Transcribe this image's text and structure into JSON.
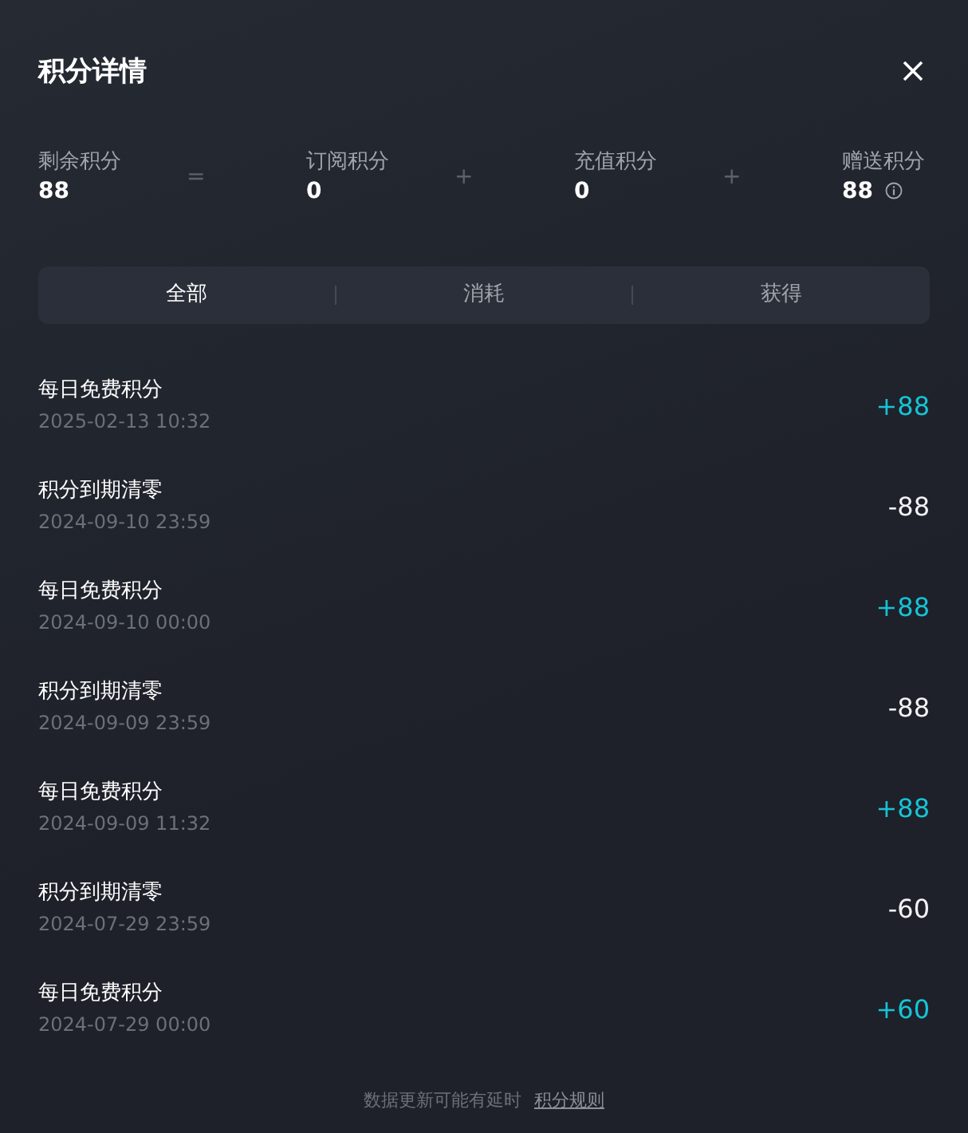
{
  "title": "积分详情",
  "summary": [
    {
      "label": "剩余积分",
      "value": "88",
      "operator": "=",
      "info": false
    },
    {
      "label": "订阅积分",
      "value": "0",
      "operator": "+",
      "info": false
    },
    {
      "label": "充值积分",
      "value": "0",
      "operator": "+",
      "info": false
    },
    {
      "label": "赠送积分",
      "value": "88",
      "info": true
    }
  ],
  "tabs": [
    {
      "label": "全部",
      "selected": true
    },
    {
      "label": "消耗",
      "selected": false
    },
    {
      "label": "获得",
      "selected": false
    }
  ],
  "records": [
    {
      "title": "每日免费积分",
      "time": "2025-02-13 10:32",
      "amount": "+88",
      "kind": "gain"
    },
    {
      "title": "积分到期清零",
      "time": "2024-09-10 23:59",
      "amount": "-88",
      "kind": "loss"
    },
    {
      "title": "每日免费积分",
      "time": "2024-09-10 00:00",
      "amount": "+88",
      "kind": "gain"
    },
    {
      "title": "积分到期清零",
      "time": "2024-09-09 23:59",
      "amount": "-88",
      "kind": "loss"
    },
    {
      "title": "每日免费积分",
      "time": "2024-09-09 11:32",
      "amount": "+88",
      "kind": "gain"
    },
    {
      "title": "积分到期清零",
      "time": "2024-07-29 23:59",
      "amount": "-60",
      "kind": "loss"
    },
    {
      "title": "每日免费积分",
      "time": "2024-07-29 00:00",
      "amount": "+60",
      "kind": "gain"
    }
  ],
  "footer": {
    "note": "数据更新可能有延时",
    "link": "积分规则"
  }
}
